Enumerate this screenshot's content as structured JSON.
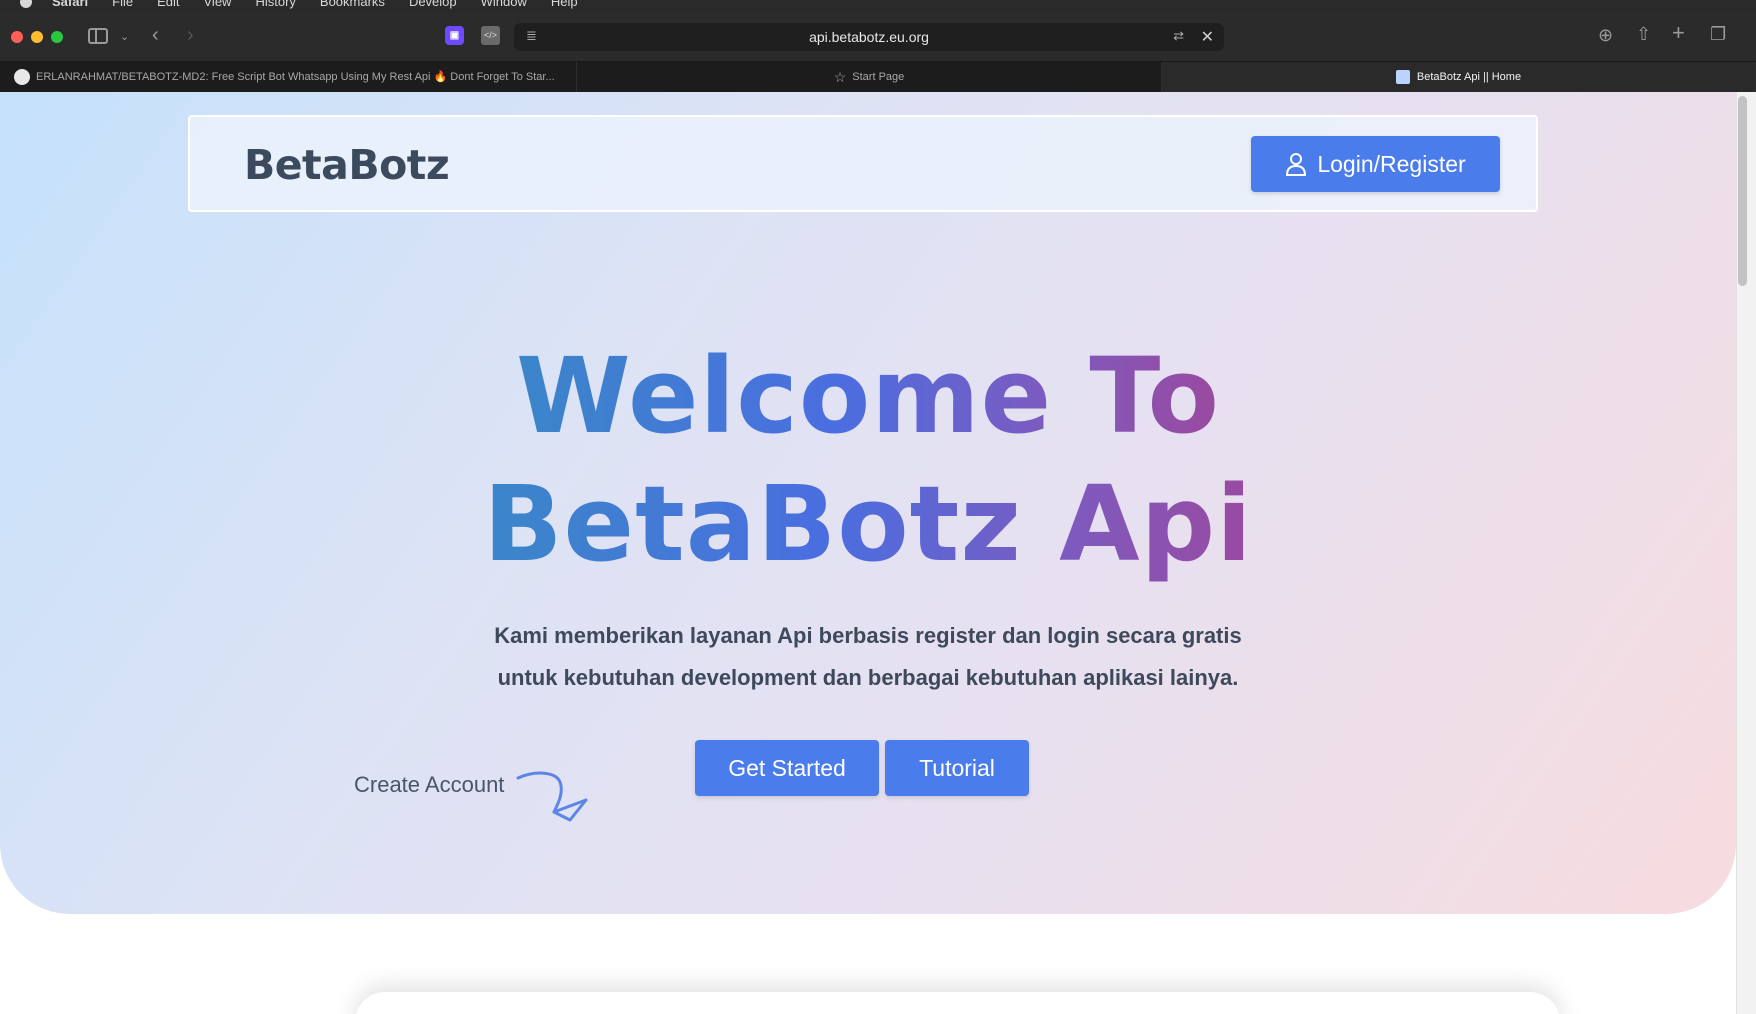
{
  "menubar": {
    "items": [
      "Safari",
      "File",
      "Edit",
      "View",
      "History",
      "Bookmarks",
      "Develop",
      "Window",
      "Help"
    ]
  },
  "browser": {
    "url": "api.betabotz.eu.org",
    "tabs": [
      {
        "label": "ERLANRAHMAT/BETABOTZ-MD2: Free Script Bot Whatsapp Using My Rest Api 🔥 Dont Forget To Star...",
        "active": false
      },
      {
        "label": "Start Page",
        "active": false
      },
      {
        "label": "BetaBotz Api || Home",
        "active": true
      }
    ]
  },
  "nav": {
    "brand": "BetaBotz",
    "login_label": "Login/Register"
  },
  "hero": {
    "headline_line1": "Welcome To",
    "headline_line2": "BetaBotz Api",
    "subtitle_line1": "Kami memberikan layanan Api berbasis register dan login secara gratis",
    "subtitle_line2": "untuk kebutuhan development dan berbagai kebutuhan aplikasi lainya.",
    "get_started_label": "Get Started",
    "tutorial_label": "Tutorial",
    "create_account_label": "Create Account"
  },
  "colors": {
    "primary_button": "#4a7cec",
    "brand_text": "#3c4a5e",
    "gradient_start": "#3b86c9",
    "gradient_end": "#9a4aa0"
  }
}
